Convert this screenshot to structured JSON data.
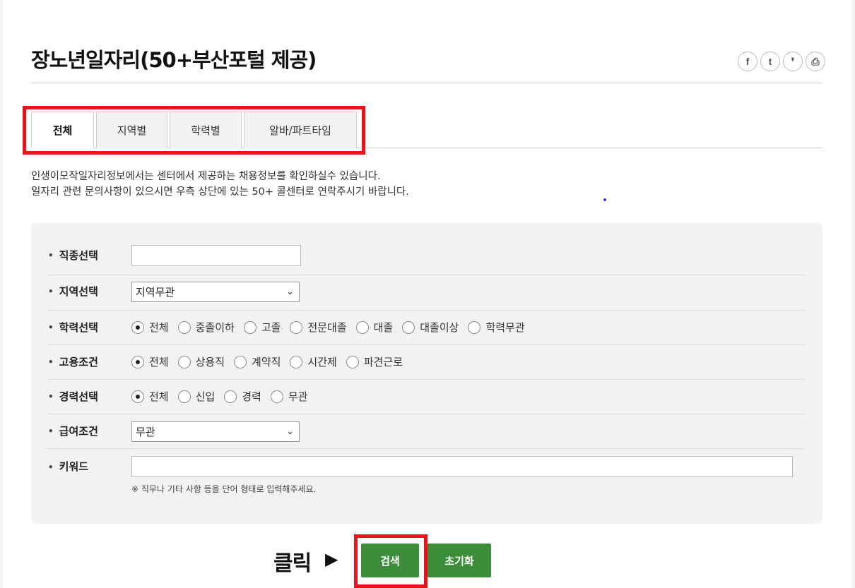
{
  "title": "장노년일자리(50+부산포털 제공)",
  "share_icons": [
    {
      "name": "facebook-icon",
      "glyph": "f"
    },
    {
      "name": "twitter-icon",
      "glyph": "t"
    },
    {
      "name": "kakaostory-icon",
      "glyph": "❜"
    },
    {
      "name": "print-icon",
      "glyph": "⎙"
    }
  ],
  "tabs": [
    {
      "label": "전체",
      "active": true
    },
    {
      "label": "지역별",
      "active": false
    },
    {
      "label": "학력별",
      "active": false
    },
    {
      "label": "알바/파트타임",
      "active": false
    }
  ],
  "description": {
    "line1": "인생이모작일자리정보에서는 센터에서 제공하는 채용정보를 확인하실수 있습니다.",
    "line2": "일자리 관련 문의사항이 있으시면 우측 상단에 있는 50+ 콜센터로 연락주시기 바랍니다."
  },
  "form": {
    "job_type": {
      "label": "직종선택",
      "value": ""
    },
    "region": {
      "label": "지역선택",
      "selected": "지역무관"
    },
    "education": {
      "label": "학력선택",
      "options": [
        {
          "label": "전체",
          "checked": true
        },
        {
          "label": "중졸이하",
          "checked": false
        },
        {
          "label": "고졸",
          "checked": false
        },
        {
          "label": "전문대졸",
          "checked": false
        },
        {
          "label": "대졸",
          "checked": false
        },
        {
          "label": "대졸이상",
          "checked": false
        },
        {
          "label": "학력무관",
          "checked": false
        }
      ]
    },
    "employment": {
      "label": "고용조건",
      "options": [
        {
          "label": "전체",
          "checked": true
        },
        {
          "label": "상용직",
          "checked": false
        },
        {
          "label": "계약직",
          "checked": false
        },
        {
          "label": "시간제",
          "checked": false
        },
        {
          "label": "파견근로",
          "checked": false
        }
      ]
    },
    "career": {
      "label": "경력선택",
      "options": [
        {
          "label": "전체",
          "checked": true
        },
        {
          "label": "신입",
          "checked": false
        },
        {
          "label": "경력",
          "checked": false
        },
        {
          "label": "무관",
          "checked": false
        }
      ]
    },
    "salary": {
      "label": "급여조건",
      "selected": "무관"
    },
    "keyword": {
      "label": "키워드",
      "value": "",
      "note": "※ 직무나 기타 사항 등을 단어 형태로 입력해주세요."
    }
  },
  "annotation": {
    "click_label": "클릭",
    "arrow": "▶"
  },
  "buttons": {
    "search": "검색",
    "reset": "초기화"
  },
  "colors": {
    "accent_green": "#3d8c3a",
    "highlight_red": "#e8141c"
  }
}
